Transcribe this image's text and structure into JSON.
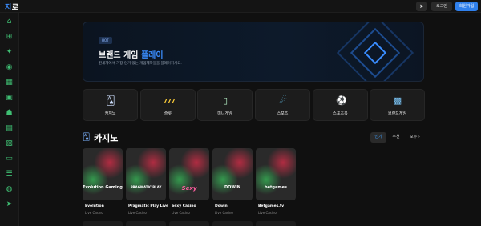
{
  "header": {
    "logo_part1": "지",
    "logo_part2": "로",
    "send_icon": "send-icon",
    "login_label": "로그인",
    "join_label": "회원가입"
  },
  "sidebar": {
    "icons": [
      "home-icon",
      "network-icon",
      "rocket-icon",
      "casino-chip-icon",
      "slot-icon",
      "controller-icon",
      "user-icon",
      "calendar-icon",
      "ticket-icon",
      "card-icon",
      "list-icon",
      "globe-icon",
      "send-icon"
    ]
  },
  "banner": {
    "tag": "HOT",
    "title_part1": "브랜드 게임 ",
    "title_part2": "플레이",
    "subtitle": "전세계에서 가장 인기 있는 게임제작들을 플레이하세요."
  },
  "categories": [
    {
      "label": "카지노",
      "icon": "cards-icon"
    },
    {
      "label": "슬롯",
      "icon": "slot-777-icon"
    },
    {
      "label": "미니게임",
      "icon": "gameboy-icon"
    },
    {
      "label": "스포츠",
      "icon": "comet-icon"
    },
    {
      "label": "스포츠북",
      "icon": "soccer-ball-icon"
    },
    {
      "label": "브랜드게임",
      "icon": "grid-blocks-icon"
    }
  ],
  "casino_section": {
    "title": "카지노",
    "filters": [
      "인기",
      "추천",
      "모두 ›"
    ]
  },
  "cards": [
    {
      "logo": "Evolution Gaming",
      "name": "Evolution",
      "sub": "Live Casino"
    },
    {
      "logo": "PRAGMATIC PLAY",
      "name": "Pragmatic Play Live",
      "sub": "Live Casino"
    },
    {
      "logo": "Sexy",
      "name": "Sexy Casino",
      "sub": "Live Casino"
    },
    {
      "logo": "DOWIN",
      "name": "Dowin",
      "sub": "Live Casino"
    },
    {
      "logo": "betgames",
      "name": "Betgames.tv",
      "sub": "Live Casino"
    }
  ],
  "colors": {
    "accent": "#2f80ed",
    "bg": "#101010",
    "sidebar_icon": "#3fbf73"
  }
}
